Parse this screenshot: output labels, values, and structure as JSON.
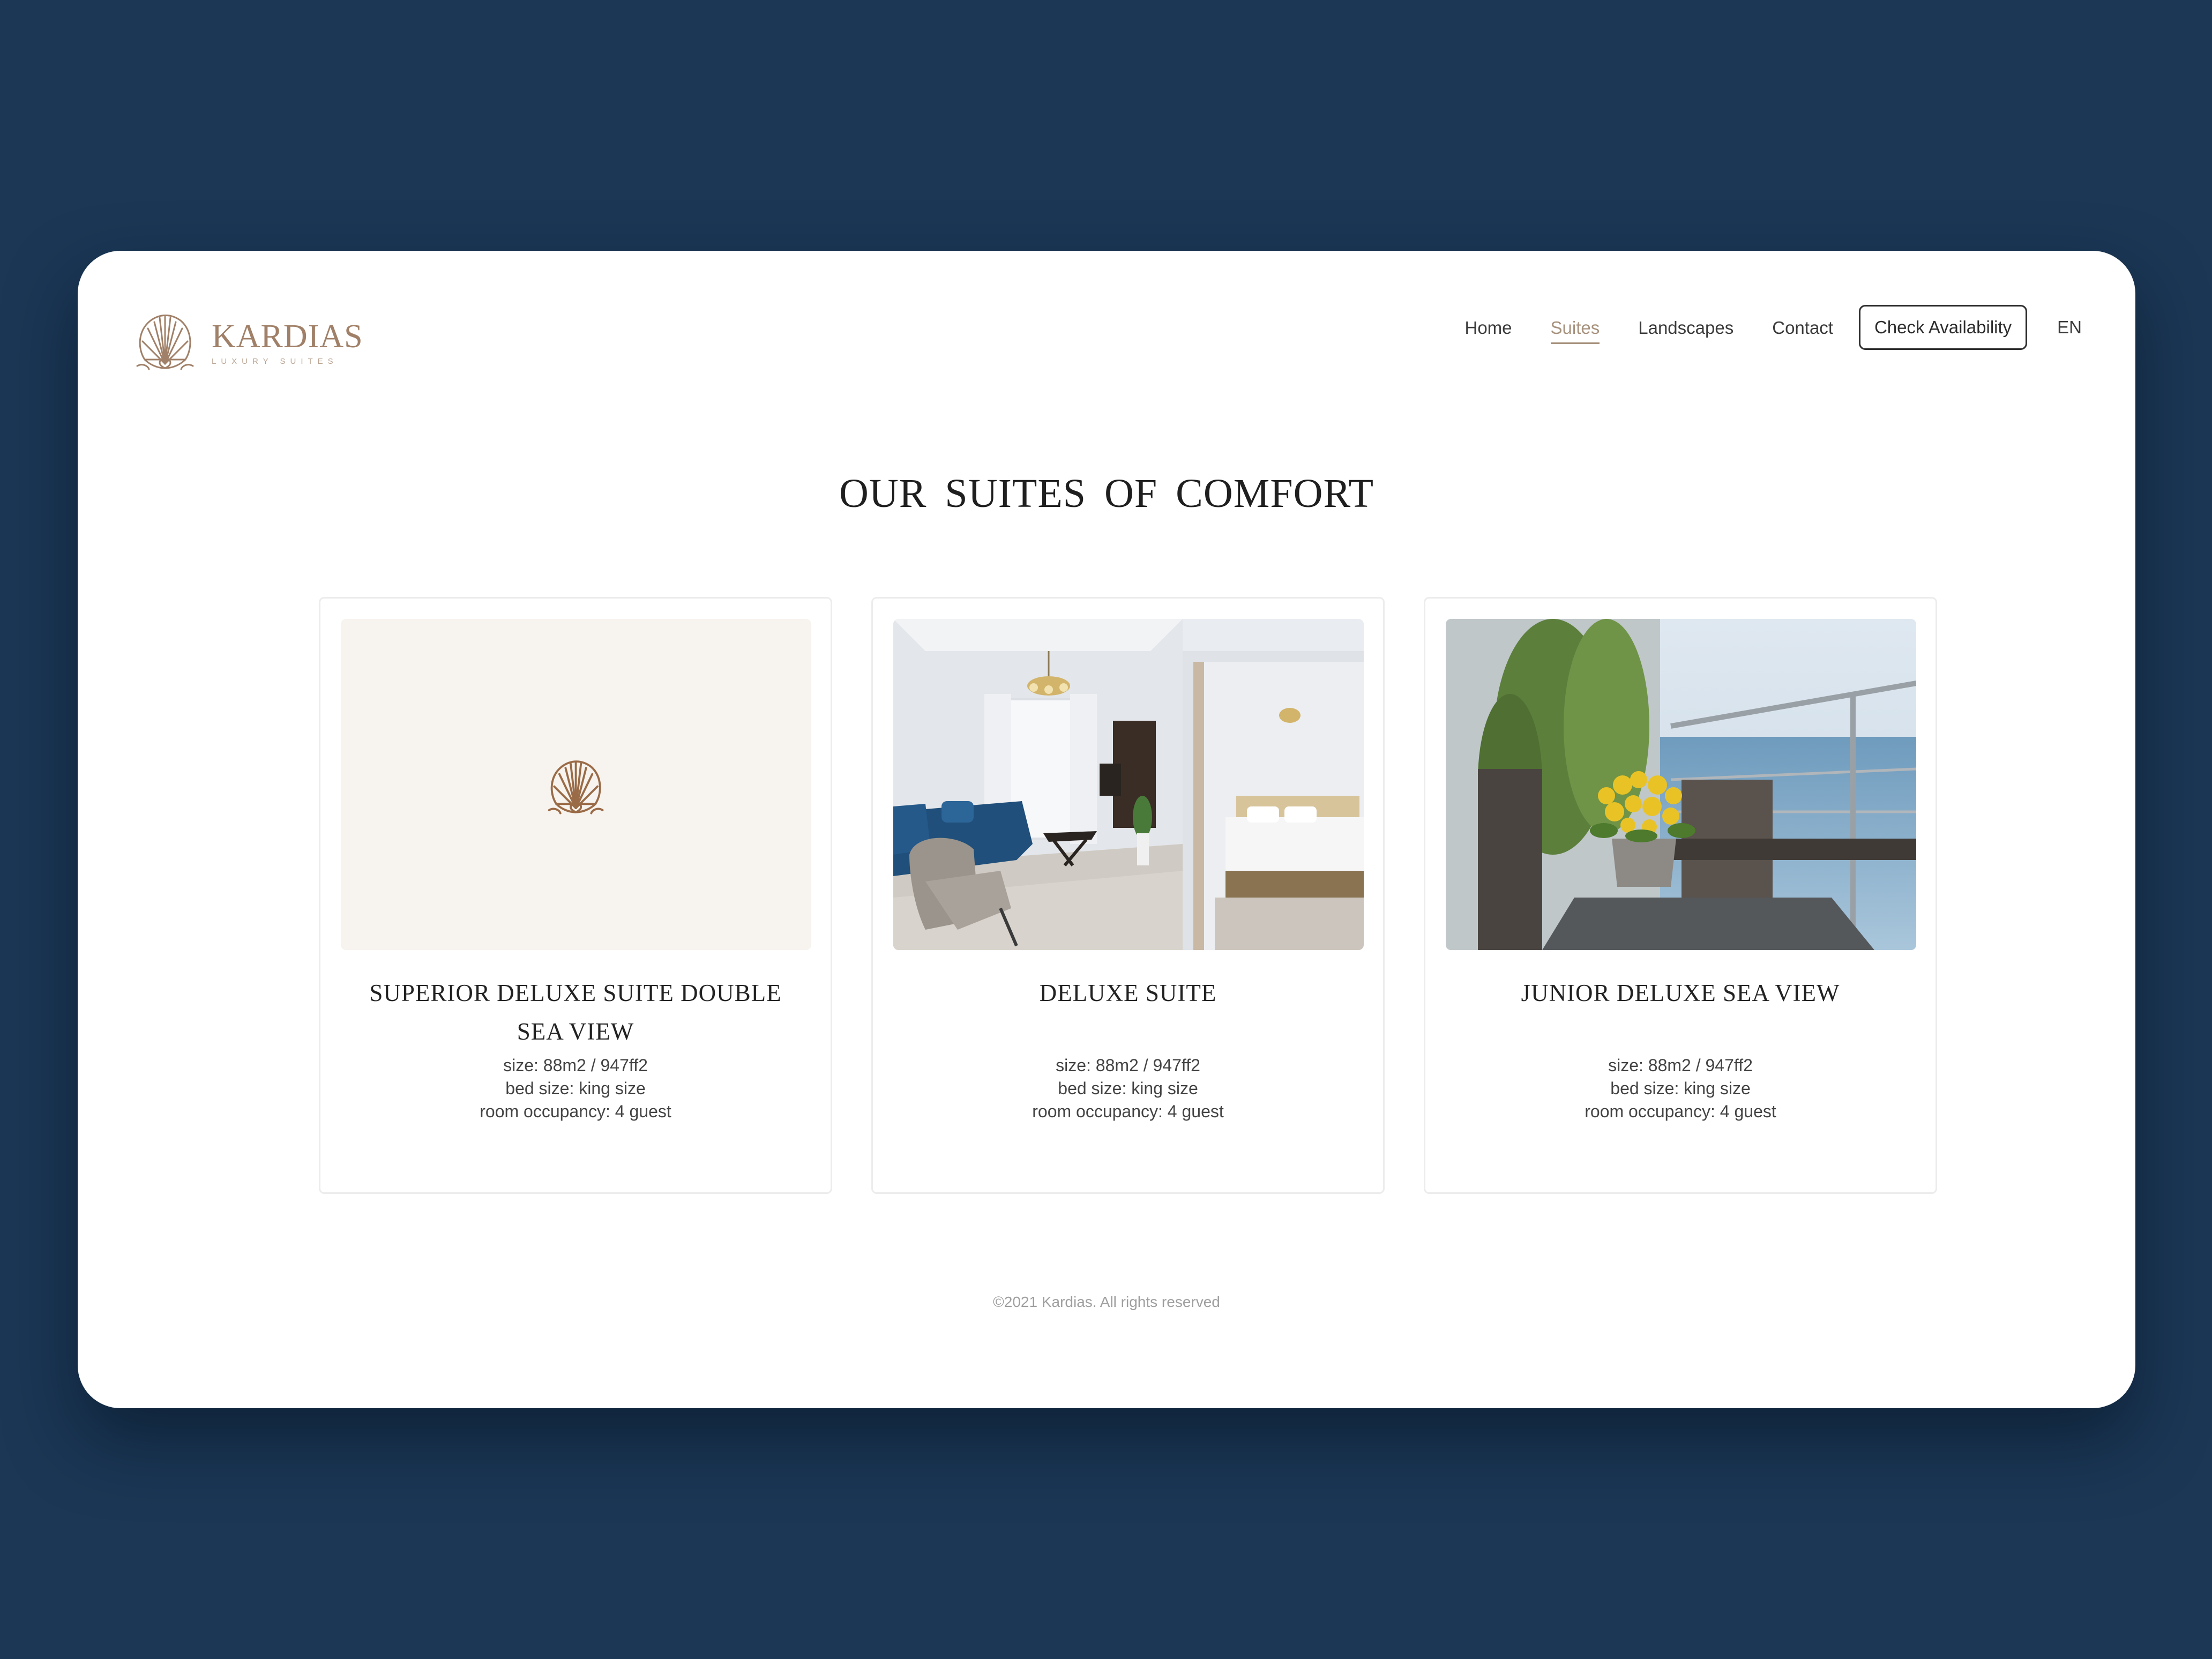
{
  "brand": {
    "name": "KARDIAS",
    "tagline": "LUXURY SUITES",
    "icon": "seashell-logo-icon"
  },
  "nav": {
    "items": [
      {
        "label": "Home",
        "active": false
      },
      {
        "label": "Suites",
        "active": true
      },
      {
        "label": "Landscapes",
        "active": false
      },
      {
        "label": "Contact",
        "active": false
      }
    ],
    "cta_label": "Check Availability",
    "language": "EN"
  },
  "page": {
    "title": "OUR SUITES OF  COMFORT"
  },
  "suites": [
    {
      "name": "SUPERIOR DELUXE SUITE DOUBLE SEA VIEW",
      "image": "placeholder-seashell",
      "size": "size: 88m2 / 947ff2",
      "bed": "bed size: king size",
      "occupancy": "room occupancy: 4 guest"
    },
    {
      "name": "DELUXE SUITE",
      "image": "living-room-photo",
      "size": "size: 88m2 / 947ff2",
      "bed": "bed size: king size",
      "occupancy": "room occupancy: 4 guest"
    },
    {
      "name": "JUNIOR DELUXE SEA VIEW",
      "image": "balcony-flowers-photo",
      "size": "size: 88m2 / 947ff2",
      "bed": "bed size: king size",
      "occupancy": "room occupancy: 4 guest"
    }
  ],
  "footer": {
    "copyright": "©2021 Kardias. All rights reserved"
  },
  "colors": {
    "background": "#1b3755",
    "card": "#ffffff",
    "brand_accent": "#a08068",
    "active_nav": "#a6917c",
    "placeholder_bg": "#f7f3ee"
  }
}
